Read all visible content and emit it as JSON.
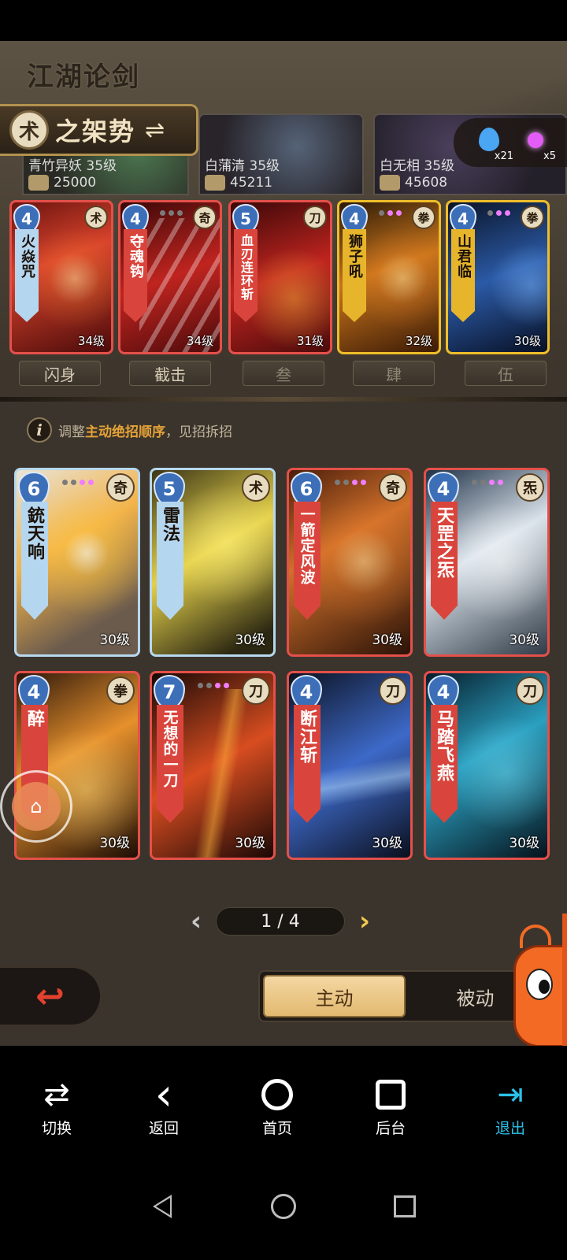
{
  "header": {
    "title": "江湖论剑"
  },
  "stance": {
    "icon_char": "术",
    "label": "之架势",
    "swap_glyph": "⇌"
  },
  "opponents": [
    {
      "name": "青竹异妖 35级",
      "power": "25000"
    },
    {
      "name": "白蒲清 35级",
      "power": "45211"
    },
    {
      "name": "白无相 35级",
      "power": "45608"
    }
  ],
  "currency": [
    {
      "icon": "water-drop-icon",
      "count": "x21"
    },
    {
      "icon": "purple-orb-icon",
      "count": "x5"
    }
  ],
  "equipped": [
    {
      "cost": "4",
      "type": "术",
      "name": "火焱咒",
      "level": "34级",
      "slot": "闪身",
      "pips": 0
    },
    {
      "cost": "4",
      "type": "奇",
      "name": "夺魂钩",
      "level": "34级",
      "slot": "截击",
      "pips": 3
    },
    {
      "cost": "5",
      "type": "刀",
      "name": "血刃连环斩",
      "level": "31级",
      "slot": "叁",
      "pips": 0
    },
    {
      "cost": "4",
      "type": "拳",
      "name": "狮子吼",
      "level": "32级",
      "slot": "肆",
      "pips": 3
    },
    {
      "cost": "4",
      "type": "拳",
      "name": "山君临",
      "level": "30级",
      "slot": "伍",
      "pips": 3
    }
  ],
  "hint": {
    "prefix": "调整",
    "highlight": "主动绝招顺序",
    "suffix": "，见招拆招",
    "icon": "i"
  },
  "cards": [
    {
      "cost": "6",
      "type": "奇",
      "name": "銃天响",
      "level": "30级",
      "pips": 4
    },
    {
      "cost": "5",
      "type": "术",
      "name": "雷法",
      "level": "30级",
      "pips": 0
    },
    {
      "cost": "6",
      "type": "奇",
      "name": "一箭定风波",
      "level": "30级",
      "pips": 4
    },
    {
      "cost": "4",
      "type": "炁",
      "name": "天罡之炁",
      "level": "30级",
      "pips": 4
    },
    {
      "cost": "4",
      "type": "拳",
      "name": "醉",
      "level": "30级",
      "pips": 0
    },
    {
      "cost": "7",
      "type": "刀",
      "name": "无想的一刀",
      "level": "30级",
      "pips": 4
    },
    {
      "cost": "4",
      "type": "刀",
      "name": "断江斩",
      "level": "30级",
      "pips": 0
    },
    {
      "cost": "4",
      "type": "刀",
      "name": "马踏飞燕",
      "level": "30级",
      "pips": 0
    }
  ],
  "pager": {
    "current": 1,
    "total": 4,
    "label": "1 / 4",
    "prev": "‹",
    "next": "›"
  },
  "tabs": {
    "active": "主动",
    "passive": "被动"
  },
  "back_arrow_glyph": "↩",
  "float_ball_glyph": "⌂",
  "system_nav": [
    {
      "label": "切换",
      "icon": "switch-icon",
      "glyph": "⇄"
    },
    {
      "label": "返回",
      "icon": "back-icon",
      "glyph": "‹"
    },
    {
      "label": "首页",
      "icon": "home-icon",
      "glyph": ""
    },
    {
      "label": "后台",
      "icon": "recents-icon",
      "glyph": ""
    },
    {
      "label": "退出",
      "icon": "exit-icon",
      "glyph": "⇥"
    }
  ],
  "colors": {
    "accent": "#e4a238",
    "exit": "#2cc0e8",
    "tab_active": "#e2b970"
  }
}
